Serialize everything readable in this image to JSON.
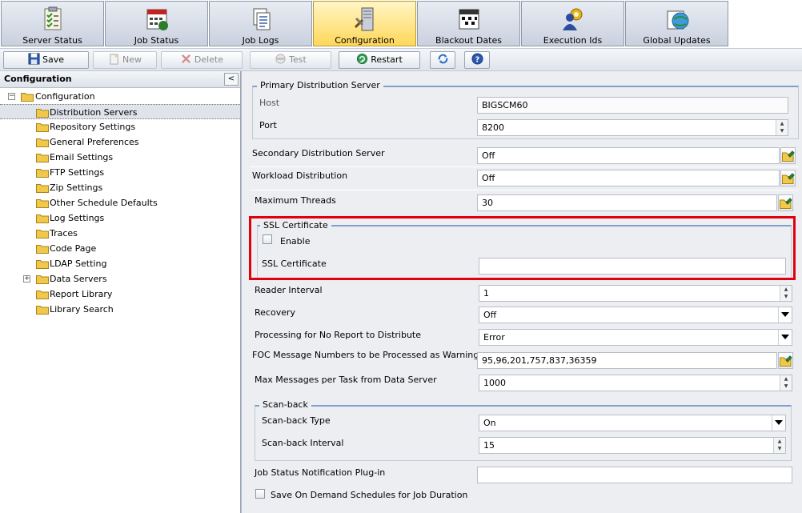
{
  "tabs": [
    {
      "label": "Server Status",
      "icon": "server-status-icon"
    },
    {
      "label": "Job Status",
      "icon": "job-status-icon"
    },
    {
      "label": "Job Logs",
      "icon": "job-logs-icon"
    },
    {
      "label": "Configuration",
      "icon": "configuration-icon",
      "active": true
    },
    {
      "label": "Blackout Dates",
      "icon": "calendar-icon"
    },
    {
      "label": "Execution Ids",
      "icon": "execution-ids-icon"
    },
    {
      "label": "Global Updates",
      "icon": "global-updates-icon"
    }
  ],
  "toolbar": {
    "save": "Save",
    "new": "New",
    "delete": "Delete",
    "test": "Test",
    "restart": "Restart"
  },
  "tree": {
    "title": "Configuration",
    "collapse": "<",
    "root": "Configuration",
    "items": [
      "Distribution Servers",
      "Repository Settings",
      "General Preferences",
      "Email Settings",
      "FTP Settings",
      "Zip Settings",
      "Other Schedule Defaults",
      "Log Settings",
      "Traces",
      "Code Page",
      "LDAP Setting",
      "Data Servers",
      "Report Library",
      "Library Search"
    ]
  },
  "form": {
    "primary": {
      "legend": "Primary Distribution Server",
      "host_label": "Host",
      "host_value": "BIGSCM60",
      "port_label": "Port",
      "port_value": "8200"
    },
    "secondary": {
      "label": "Secondary Distribution Server",
      "value": "Off"
    },
    "workload": {
      "label": "Workload Distribution",
      "value": "Off"
    },
    "threads": {
      "label": "Maximum Threads",
      "value": "30"
    },
    "ssl": {
      "legend": "SSL Certificate",
      "enable_label": "Enable",
      "cert_label": "SSL Certificate",
      "cert_value": ""
    },
    "reader": {
      "label": "Reader Interval",
      "value": "1"
    },
    "recovery": {
      "label": "Recovery",
      "value": "Off"
    },
    "noreport": {
      "label": "Processing for No Report to Distribute",
      "value": "Error"
    },
    "foc": {
      "label": "FOC Message Numbers to be Processed as Warnings",
      "value": "95,96,201,757,837,36359"
    },
    "maxmsg": {
      "label": "Max Messages per Task from Data Server",
      "value": "1000"
    },
    "scanback": {
      "legend": "Scan-back",
      "type_label": "Scan-back Type",
      "type_value": "On",
      "interval_label": "Scan-back Interval",
      "interval_value": "15"
    },
    "plugin": {
      "label": "Job Status Notification Plug-in",
      "value": ""
    },
    "ondemand": {
      "label": "Save On Demand Schedules for Job Duration"
    }
  },
  "colors": {
    "highlight": "#e2000f",
    "active_tab": "#ffd75a",
    "folder": "#f1c94a"
  }
}
